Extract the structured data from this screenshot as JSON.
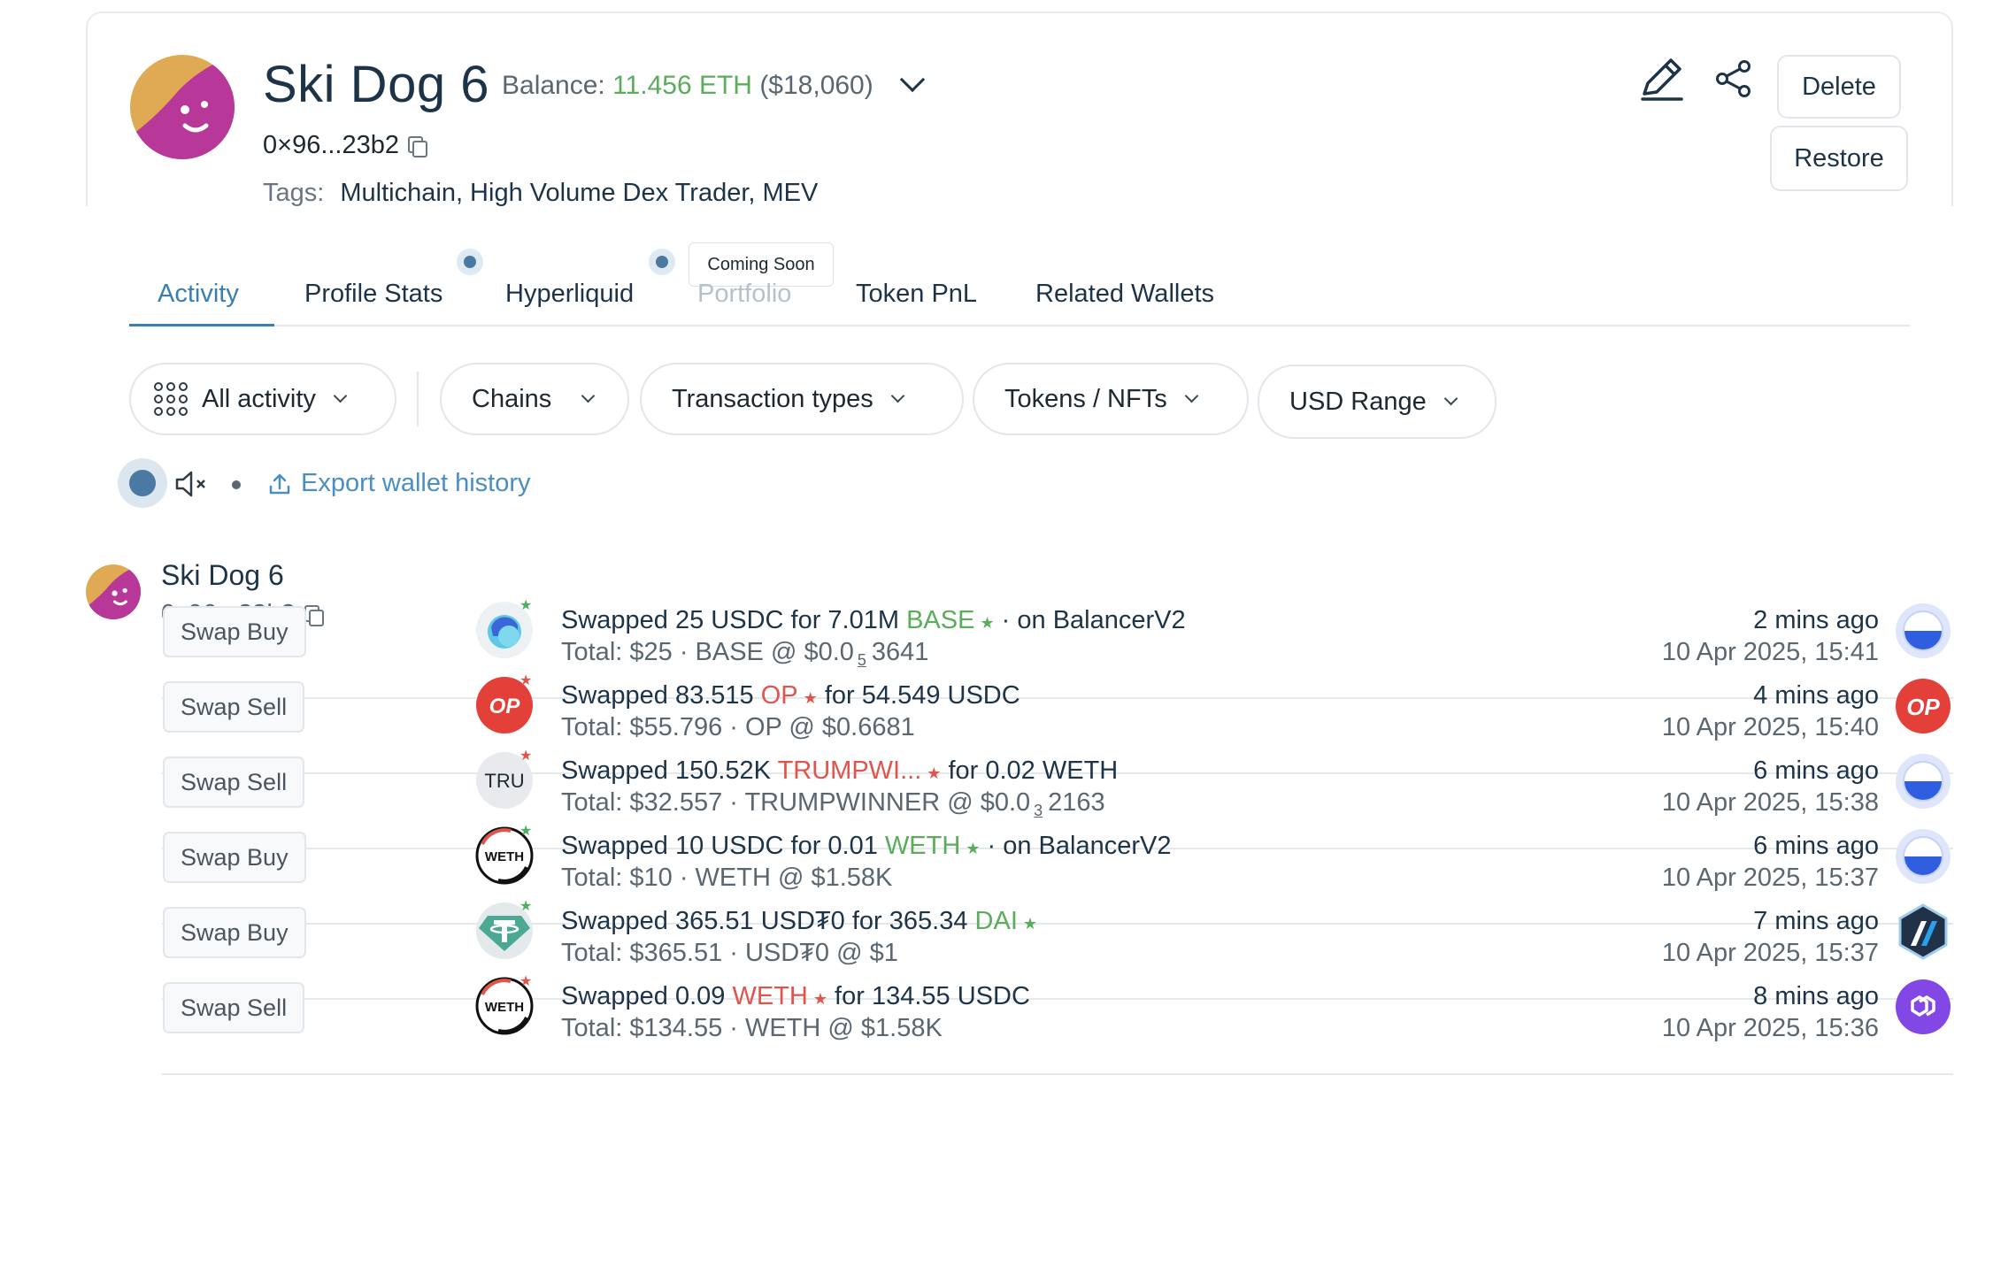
{
  "wallet": {
    "name": "Ski Dog 6",
    "balance_label": "Balance:",
    "balance_eth": "11.456 ETH",
    "balance_usd": "($18,060)",
    "address": "0×96...23b2",
    "tags_label": "Tags:",
    "tags_value": "Multichain, High Volume Dex Trader, MEV"
  },
  "header_actions": {
    "edit_icon": "pencil-icon",
    "share_icon": "share-icon",
    "delete_label": "Delete",
    "restore_label": "Restore"
  },
  "tabs": [
    {
      "label": "Activity",
      "state": "active"
    },
    {
      "label": "Profile Stats",
      "state": "normal"
    },
    {
      "label": "Hyperliquid",
      "state": "normal"
    },
    {
      "label": "Portfolio",
      "state": "disabled"
    },
    {
      "label": "Token PnL",
      "state": "normal"
    },
    {
      "label": "Related Wallets",
      "state": "normal"
    }
  ],
  "tooltip": "Coming Soon",
  "filters": {
    "all_activity": "All activity",
    "chains": "Chains",
    "transaction_types": "Transaction types",
    "tokens_nfts": "Tokens / NFTs",
    "usd_range": "USD Range"
  },
  "export_label": "Export wallet history",
  "group": {
    "name": "Ski Dog 6",
    "address": "0x96...23b2"
  },
  "transactions": [
    {
      "type": "Swap Buy",
      "token_icon": "base-token-icon",
      "star": "green",
      "l1_pre": "Swapped 25 USDC for 7.01M ",
      "l1_token": "BASE",
      "l1_post": " · on BalancerV2",
      "l2_pre": "Total: $25 · BASE @ $0.0",
      "l2_sub": "5",
      "l2_post": "3641",
      "ago": "2 mins ago",
      "date": "10 Apr 2025, 15:41",
      "chain": "base-chain-icon"
    },
    {
      "type": "Swap Sell",
      "token_icon": "op-token-icon",
      "star": "red",
      "l1_pre": "Swapped 83.515 ",
      "l1_token": "OP",
      "l1_post": " for 54.549 USDC",
      "l2_pre": "Total: $55.796 · OP @ $0.6681",
      "l2_sub": "",
      "l2_post": "",
      "ago": "4 mins ago",
      "date": "10 Apr 2025, 15:40",
      "chain": "optimism-chain-icon"
    },
    {
      "type": "Swap Sell",
      "token_icon": "tru-token-icon",
      "star": "red",
      "l1_pre": "Swapped 150.52K ",
      "l1_token": "TRUMPWI...",
      "l1_post": " for 0.02 WETH",
      "l2_pre": "Total: $32.557 · TRUMPWINNER @ $0.0",
      "l2_sub": "3",
      "l2_post": "2163",
      "ago": "6 mins ago",
      "date": "10 Apr 2025, 15:38",
      "chain": "base-chain-icon"
    },
    {
      "type": "Swap Buy",
      "token_icon": "weth-token-icon",
      "star": "green",
      "l1_pre": "Swapped 10 USDC for 0.01 ",
      "l1_token": "WETH",
      "l1_post": " · on BalancerV2",
      "l2_pre": "Total: $10 · WETH @ $1.58K",
      "l2_sub": "",
      "l2_post": "",
      "ago": "6 mins ago",
      "date": "10 Apr 2025, 15:37",
      "chain": "base-chain-icon"
    },
    {
      "type": "Swap Buy",
      "token_icon": "usdt0-token-icon",
      "star": "green",
      "l1_pre": "Swapped 365.51 USD₮0 for 365.34 ",
      "l1_token": "DAI",
      "l1_post": "",
      "l2_pre": "Total: $365.51 · USD₮0 @ $1",
      "l2_sub": "",
      "l2_post": "",
      "ago": "7 mins ago",
      "date": "10 Apr 2025, 15:37",
      "chain": "arbitrum-chain-icon"
    },
    {
      "type": "Swap Sell",
      "token_icon": "weth-token-icon",
      "star": "red",
      "l1_pre": "Swapped 0.09 ",
      "l1_token": "WETH",
      "l1_post": " for 134.55 USDC",
      "l2_pre": "Total: $134.55 · WETH @ $1.58K",
      "l2_sub": "",
      "l2_post": "",
      "ago": "8 mins ago",
      "date": "10 Apr 2025, 15:36",
      "chain": "polygon-chain-icon"
    }
  ],
  "colors": {
    "accent": "#3b7fb1",
    "green_token": "#5bac5b",
    "red_token": "#e0544c",
    "link": "#4a8fc2"
  }
}
